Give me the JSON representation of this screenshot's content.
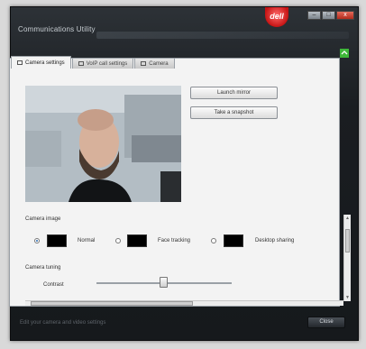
{
  "window": {
    "title": "Communications Utility",
    "logo_text": "dell",
    "controls": {
      "minimize": "–",
      "maximize": "□",
      "close": "x"
    }
  },
  "tabs": [
    {
      "label": "Camera settings",
      "active": true
    },
    {
      "label": "VoIP call settings",
      "active": false
    },
    {
      "label": "Camera",
      "active": false
    }
  ],
  "buttons": {
    "launch_mirror": "Launch mirror",
    "take_snapshot": "Take a snapshot"
  },
  "camera_image": {
    "label": "Camera image",
    "options": [
      {
        "label": "Normal",
        "selected": true
      },
      {
        "label": "Face tracking",
        "selected": false
      },
      {
        "label": "Desktop sharing",
        "selected": false
      }
    ]
  },
  "camera_tuning": {
    "label": "Camera tuning",
    "contrast_label": "Contrast",
    "contrast_level": 0.47
  },
  "status_bar": {
    "text": "Edit your camera and video settings",
    "close_label": "Close"
  },
  "colors": {
    "chrome_dark": "#1a1d21",
    "panel_bg": "#f3f3f3",
    "accent_red": "#c61414",
    "sync_green": "#3fb83a"
  }
}
